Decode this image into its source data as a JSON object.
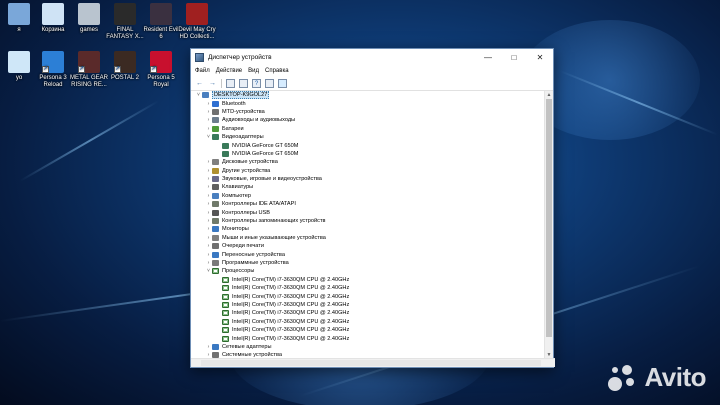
{
  "desktop": {
    "icons": [
      {
        "label": "я",
        "color": "#7aa7d9"
      },
      {
        "label": "Корзина",
        "color": "#cfe3f5"
      },
      {
        "label": "games",
        "color": "#b9c4cf"
      },
      {
        "label": "FINAL FANTASY X...",
        "color": "#2a2a2a"
      },
      {
        "label": "Resident Evil 6",
        "color": "#3a3040"
      },
      {
        "label": "Devil May Cry HD Collecti...",
        "color": "#a02020"
      },
      {
        "label": "yo",
        "color": "#cfe7f8"
      },
      {
        "label": "Persona 3 Reload",
        "color": "#2c7fd6"
      },
      {
        "label": "METAL GEAR RISING RE...",
        "color": "#5a2a2a"
      },
      {
        "label": "POSTAL 2",
        "color": "#3b2a22"
      },
      {
        "label": "Persona 5 Royal",
        "color": "#c8102e"
      }
    ]
  },
  "window": {
    "title": "Диспетчер устройств",
    "menu": [
      "Файл",
      "Действие",
      "Вид",
      "Справка"
    ],
    "tree": [
      {
        "label": "DESKTOP-K9GOL27",
        "level": 0,
        "expander": "˅",
        "icon": "computer-icon",
        "color": "#4a7fbf"
      },
      {
        "label": "Bluetooth",
        "level": 1,
        "expander": "›",
        "icon": "bluetooth-icon",
        "color": "#2f6fd1"
      },
      {
        "label": "MTD-устройства",
        "level": 1,
        "expander": "›",
        "icon": "mtd-icon",
        "color": "#707070"
      },
      {
        "label": "Аудиовходы и аудиовыходы",
        "level": 1,
        "expander": "›",
        "icon": "audio-icon",
        "color": "#6d7d8d"
      },
      {
        "label": "Батареи",
        "level": 1,
        "expander": "›",
        "icon": "battery-icon",
        "color": "#4f9a3a"
      },
      {
        "label": "Видеоадаптеры",
        "level": 1,
        "expander": "˅",
        "icon": "display-adapter-icon",
        "color": "#3a7a5a"
      },
      {
        "label": "NVIDIA GeForce GT 650M",
        "level": 2,
        "expander": "",
        "icon": "display-adapter-icon",
        "color": "#3a7a5a"
      },
      {
        "label": "NVIDIA GeForce GT 650M",
        "level": 2,
        "expander": "",
        "icon": "display-adapter-icon",
        "color": "#3a7a5a"
      },
      {
        "label": "Дисковые устройства",
        "level": 1,
        "expander": "›",
        "icon": "disk-icon",
        "color": "#808080"
      },
      {
        "label": "Другие устройства",
        "level": 1,
        "expander": "›",
        "icon": "unknown-device-icon",
        "color": "#b09030"
      },
      {
        "label": "Звуковые, игровые и видеоустройства",
        "level": 1,
        "expander": "›",
        "icon": "sound-icon",
        "color": "#6a6a8a"
      },
      {
        "label": "Клавиатуры",
        "level": 1,
        "expander": "›",
        "icon": "keyboard-icon",
        "color": "#606060"
      },
      {
        "label": "Компьютер",
        "level": 1,
        "expander": "›",
        "icon": "computer-icon",
        "color": "#4a7fbf"
      },
      {
        "label": "Контроллеры IDE ATA/ATAPI",
        "level": 1,
        "expander": "›",
        "icon": "ide-icon",
        "color": "#707a6a"
      },
      {
        "label": "Контроллеры USB",
        "level": 1,
        "expander": "›",
        "icon": "usb-icon",
        "color": "#555555"
      },
      {
        "label": "Контроллеры запоминающих устройств",
        "level": 1,
        "expander": "›",
        "icon": "storage-icon",
        "color": "#707a6a"
      },
      {
        "label": "Мониторы",
        "level": 1,
        "expander": "›",
        "icon": "monitor-icon",
        "color": "#3a78c2"
      },
      {
        "label": "Мыши и иные указывающие устройства",
        "level": 1,
        "expander": "›",
        "icon": "mouse-icon",
        "color": "#808080"
      },
      {
        "label": "Очереди печати",
        "level": 1,
        "expander": "›",
        "icon": "printer-icon",
        "color": "#707070"
      },
      {
        "label": "Переносные устройства",
        "level": 1,
        "expander": "›",
        "icon": "portable-device-icon",
        "color": "#3a78c2"
      },
      {
        "label": "Программные устройства",
        "level": 1,
        "expander": "›",
        "icon": "software-device-icon",
        "color": "#7a7a7a"
      },
      {
        "label": "Процессоры",
        "level": 1,
        "expander": "˅",
        "icon": "processor-icon",
        "color": "#2e6b2e"
      },
      {
        "label": "Intel(R) Core(TM) i7-3630QM CPU @ 2.40GHz",
        "level": 2,
        "expander": "",
        "icon": "processor-icon",
        "color": "#2e6b2e"
      },
      {
        "label": "Intel(R) Core(TM) i7-3630QM CPU @ 2.40GHz",
        "level": 2,
        "expander": "",
        "icon": "processor-icon",
        "color": "#2e6b2e"
      },
      {
        "label": "Intel(R) Core(TM) i7-3630QM CPU @ 2.40GHz",
        "level": 2,
        "expander": "",
        "icon": "processor-icon",
        "color": "#2e6b2e"
      },
      {
        "label": "Intel(R) Core(TM) i7-3630QM CPU @ 2.40GHz",
        "level": 2,
        "expander": "",
        "icon": "processor-icon",
        "color": "#2e6b2e"
      },
      {
        "label": "Intel(R) Core(TM) i7-3630QM CPU @ 2.40GHz",
        "level": 2,
        "expander": "",
        "icon": "processor-icon",
        "color": "#2e6b2e"
      },
      {
        "label": "Intel(R) Core(TM) i7-3630QM CPU @ 2.40GHz",
        "level": 2,
        "expander": "",
        "icon": "processor-icon",
        "color": "#2e6b2e"
      },
      {
        "label": "Intel(R) Core(TM) i7-3630QM CPU @ 2.40GHz",
        "level": 2,
        "expander": "",
        "icon": "processor-icon",
        "color": "#2e6b2e"
      },
      {
        "label": "Intel(R) Core(TM) i7-3630QM CPU @ 2.40GHz",
        "level": 2,
        "expander": "",
        "icon": "processor-icon",
        "color": "#2e6b2e"
      },
      {
        "label": "Сетевые адаптеры",
        "level": 1,
        "expander": "›",
        "icon": "network-adapter-icon",
        "color": "#3a78c2"
      },
      {
        "label": "Системные устройства",
        "level": 1,
        "expander": "›",
        "icon": "system-device-icon",
        "color": "#707070"
      }
    ]
  },
  "watermark": {
    "text": "Avito"
  }
}
